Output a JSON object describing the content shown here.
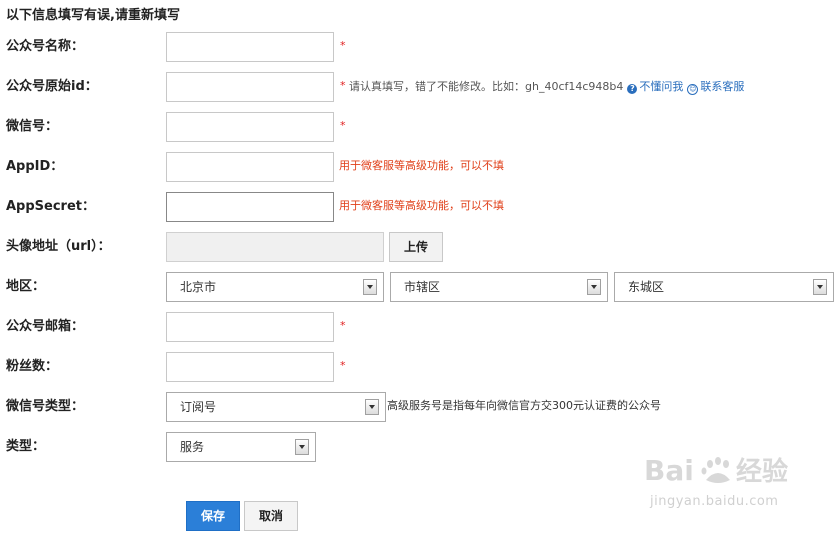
{
  "form": {
    "header": "以下信息填写有误,请重新填写",
    "required_mark": "*",
    "name": {
      "label": "公众号名称：",
      "value": ""
    },
    "original_id": {
      "label": "公众号原始id：",
      "value": "",
      "hint": "请认真填写，错了不能修改。比如：gh_40cf14c948b4",
      "help_link": "不懂问我",
      "support_link": "联系客服"
    },
    "wechat_id": {
      "label": "微信号：",
      "value": ""
    },
    "appid": {
      "label": "AppID：",
      "value": "",
      "hint": "用于微客服等高级功能，可以不填"
    },
    "appsecret": {
      "label": "AppSecret：",
      "value": "",
      "hint": "用于微客服等高级功能，可以不填"
    },
    "avatar": {
      "label": "头像地址（url）：",
      "value": "",
      "upload_label": "上传"
    },
    "region": {
      "label": "地区：",
      "province": "北京市",
      "city": "市辖区",
      "district": "东城区"
    },
    "email": {
      "label": "公众号邮箱：",
      "value": ""
    },
    "fans": {
      "label": "粉丝数：",
      "value": ""
    },
    "account_type": {
      "label": "微信号类型：",
      "value": "订阅号",
      "hint": "高级服务号是指每年向微信官方交300元认证费的公众号"
    },
    "category": {
      "label": "类型：",
      "value": "服务"
    },
    "save_label": "保存",
    "cancel_label": "取消"
  },
  "watermark": {
    "sub": "jingyan.baidu.com"
  },
  "colors": {
    "primary": "#2b7fd8",
    "error": "#e0401a",
    "required": "#e02020",
    "link": "#2a6ebd"
  }
}
